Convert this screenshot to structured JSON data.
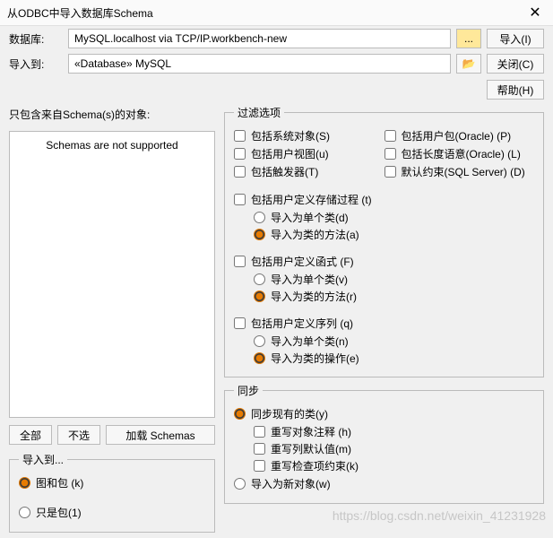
{
  "title": "从ODBC中导入数据库Schema",
  "close_glyph": "✕",
  "form": {
    "db_label": "数据库:",
    "db_value": "MySQL.localhost via TCP/IP.workbench-new",
    "to_label": "导入到:",
    "to_value": "«Database» MySQL",
    "browse_btn": "...",
    "import_btn": "导入(I)",
    "close_btn": "关闭(C)",
    "help_btn": "帮助(H)"
  },
  "left": {
    "label": "只包含来自Schema(s)的对象:",
    "list_text": "Schemas are not supported",
    "btn_all": "全部",
    "btn_none": "不选",
    "btn_load": "加载 Schemas",
    "fieldset_title": "导入到...",
    "radio1": "图和包 (k)",
    "radio2": "只是包(1)"
  },
  "filter": {
    "legend": "过滤选项",
    "c1": "包括系统对象(S)",
    "c2": "包括用户包(Oracle) (P)",
    "c3": "包括用户视图(u)",
    "c4": "包括长度语意(Oracle) (L)",
    "c5": "包括触发器(T)",
    "c6": "默认约束(SQL Server) (D)",
    "g1_chk": "包括用户定义存储过程 (t)",
    "g1_r1": "导入为单个类(d)",
    "g1_r2": "导入为类的方法(a)",
    "g2_chk": "包括用户定义函式 (F)",
    "g2_r1": "导入为单个类(v)",
    "g2_r2": "导入为类的方法(r)",
    "g3_chk": "包括用户定义序列 (q)",
    "g3_r1": "导入为单个类(n)",
    "g3_r2": "导入为类的操作(e)"
  },
  "sync": {
    "legend": "同步",
    "r1": "同步现有的类(y)",
    "c1": "重写对象注释 (h)",
    "c2": "重写列默认值(m)",
    "c3": "重写检查项约束(k)",
    "r2": "导入为新对象(w)"
  },
  "icons": {
    "folder_glyph": "📂"
  },
  "watermark": "https://blog.csdn.net/weixin_41231928"
}
